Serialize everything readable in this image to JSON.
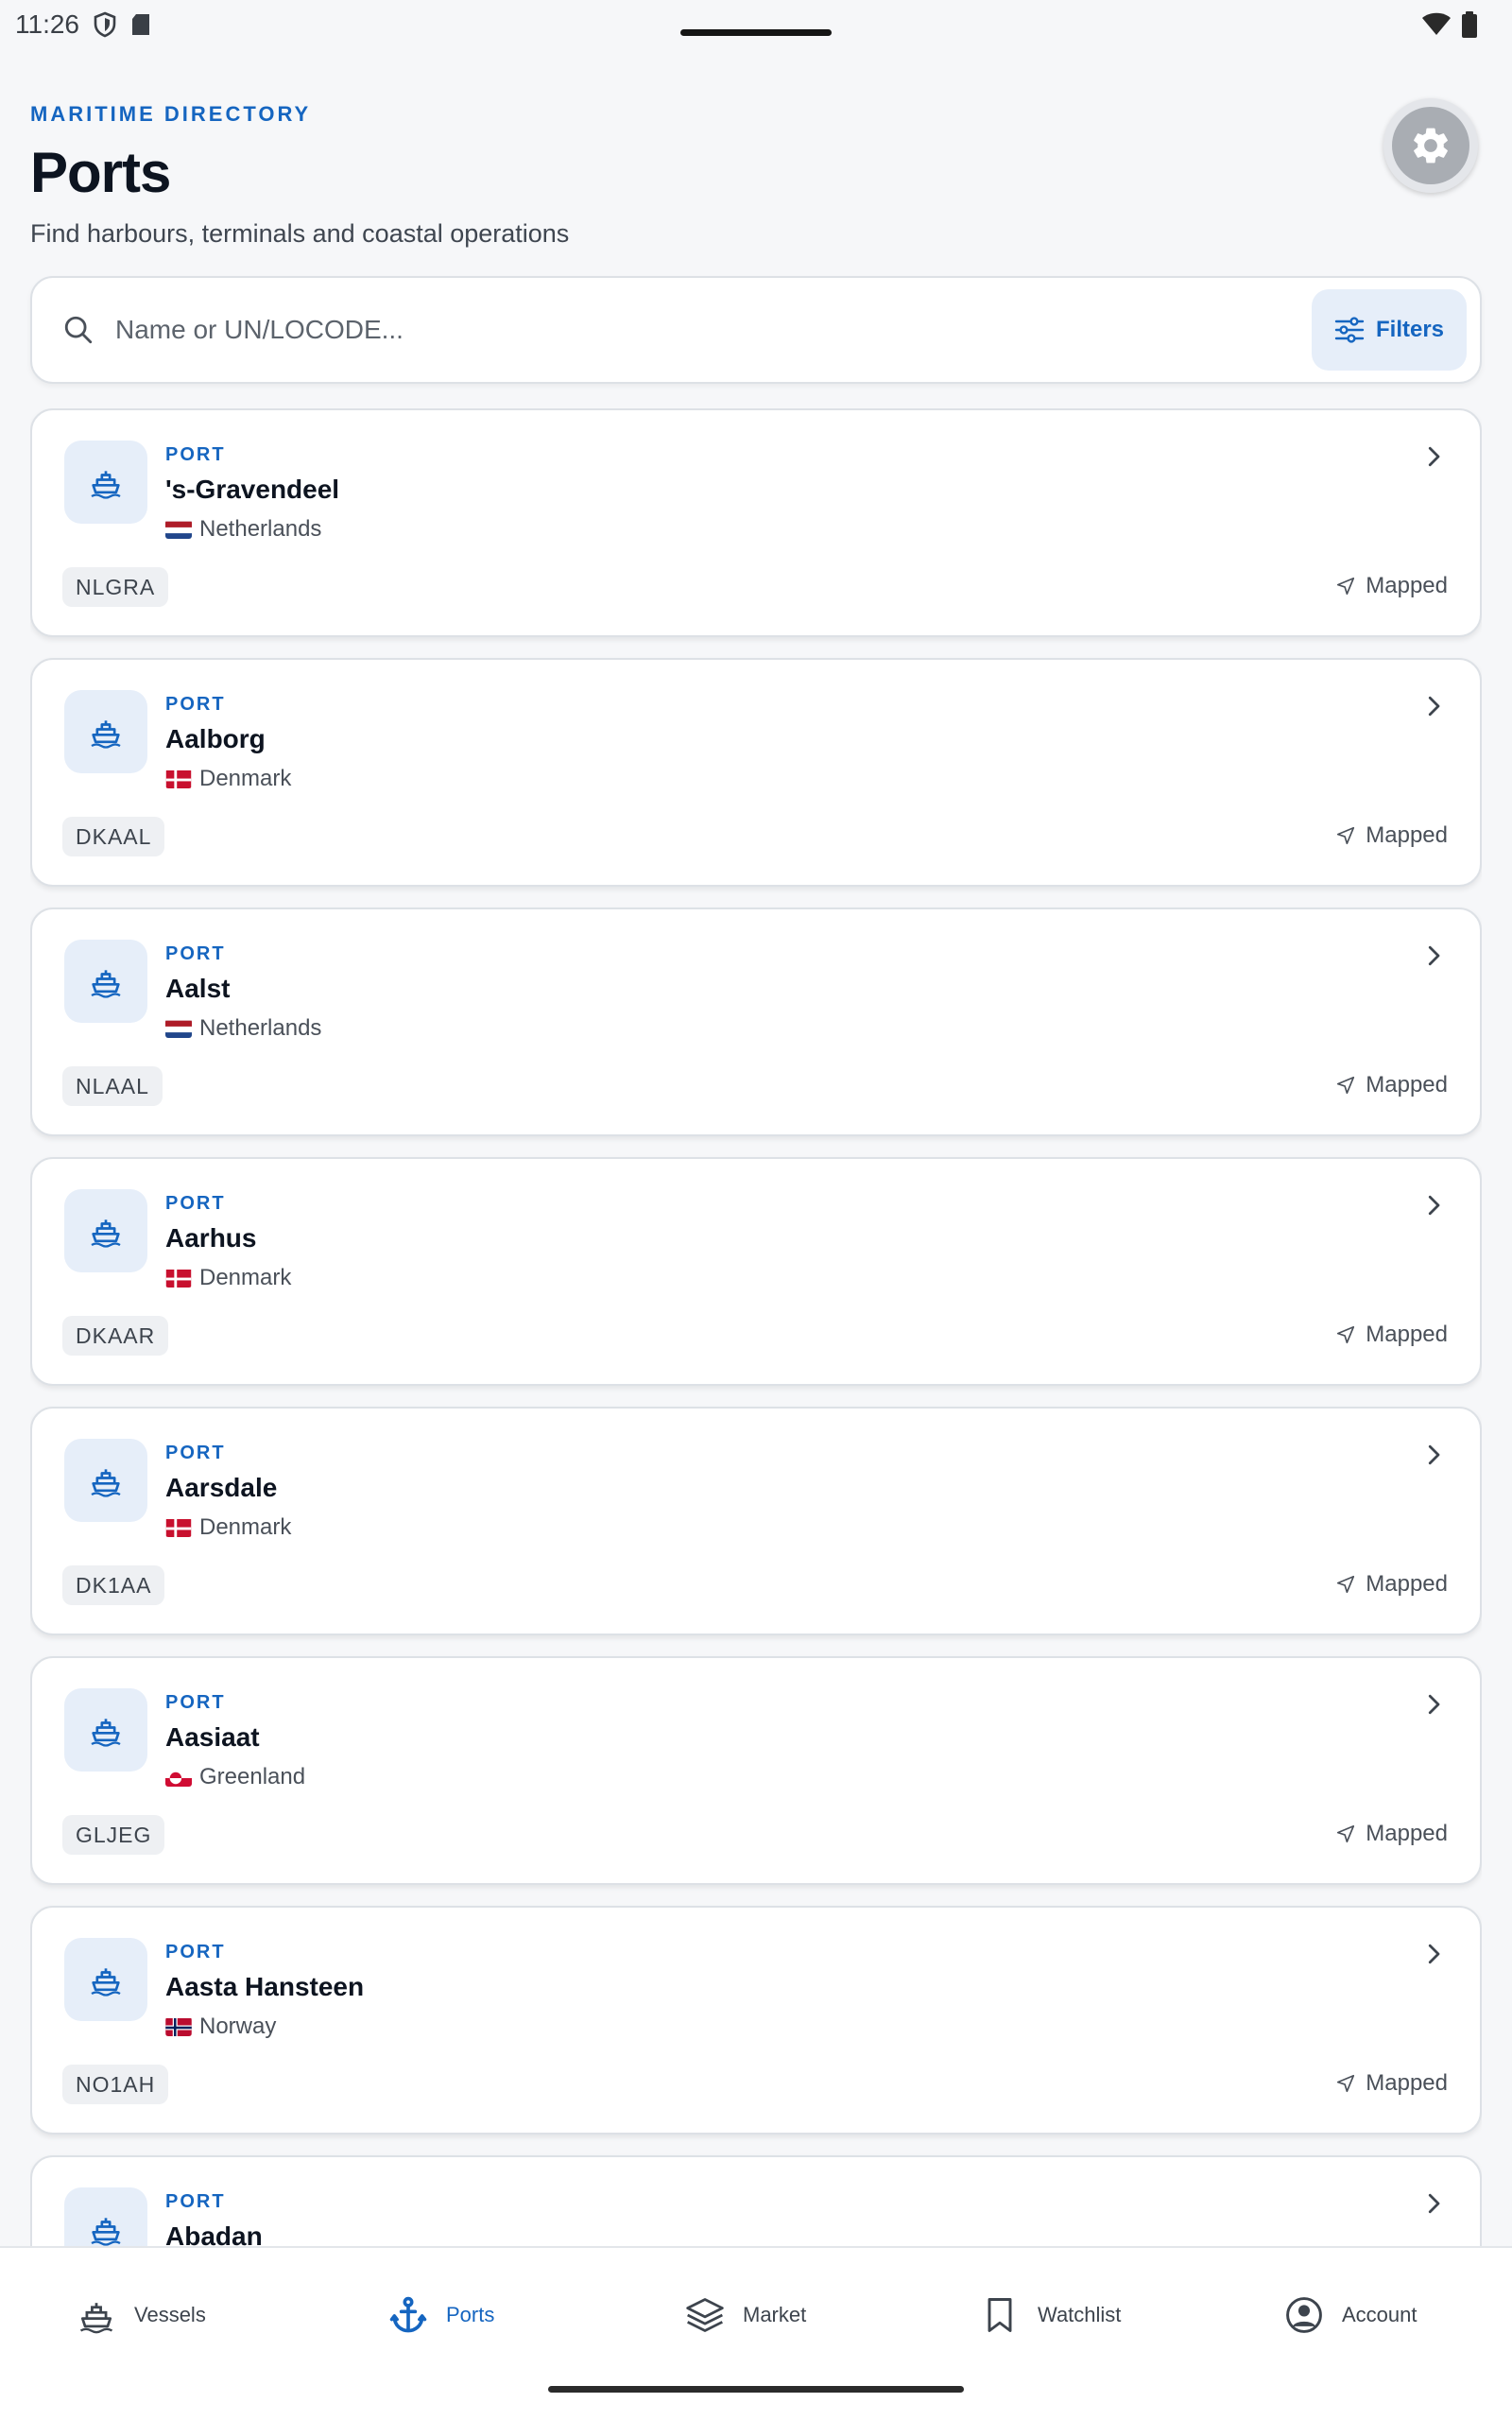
{
  "status_bar": {
    "time": "11:26"
  },
  "header": {
    "eyebrow": "MARITIME DIRECTORY",
    "title": "Ports",
    "subtitle": "Find harbours, terminals and coastal operations"
  },
  "search": {
    "placeholder": "Name or UN/LOCODE...",
    "value": "",
    "filters_label": "Filters"
  },
  "ports": [
    {
      "type": "PORT",
      "name": "'s-Gravendeel",
      "country": "Netherlands",
      "flag": "nl",
      "code": "NLGRA",
      "status": "Mapped"
    },
    {
      "type": "PORT",
      "name": "Aalborg",
      "country": "Denmark",
      "flag": "dk",
      "code": "DKAAL",
      "status": "Mapped"
    },
    {
      "type": "PORT",
      "name": "Aalst",
      "country": "Netherlands",
      "flag": "nl",
      "code": "NLAAL",
      "status": "Mapped"
    },
    {
      "type": "PORT",
      "name": "Aarhus",
      "country": "Denmark",
      "flag": "dk",
      "code": "DKAAR",
      "status": "Mapped"
    },
    {
      "type": "PORT",
      "name": "Aarsdale",
      "country": "Denmark",
      "flag": "dk",
      "code": "DK1AA",
      "status": "Mapped"
    },
    {
      "type": "PORT",
      "name": "Aasiaat",
      "country": "Greenland",
      "flag": "gl",
      "code": "GLJEG",
      "status": "Mapped"
    },
    {
      "type": "PORT",
      "name": "Aasta Hansteen",
      "country": "Norway",
      "flag": "no",
      "code": "NO1AH",
      "status": "Mapped"
    },
    {
      "type": "PORT",
      "name": "Abadan",
      "country": "",
      "flag": "",
      "code": "",
      "status": ""
    }
  ],
  "nav": [
    {
      "label": "Vessels",
      "icon": "ship-icon",
      "active": false
    },
    {
      "label": "Ports",
      "icon": "anchor-icon",
      "active": true
    },
    {
      "label": "Market",
      "icon": "layers-icon",
      "active": false
    },
    {
      "label": "Watchlist",
      "icon": "bookmark-icon",
      "active": false
    },
    {
      "label": "Account",
      "icon": "account-icon",
      "active": false
    }
  ],
  "colors": {
    "accent": "#1565c0",
    "background": "#f6f7f9",
    "card": "#ffffff",
    "icon_tile": "#e6eef9"
  }
}
